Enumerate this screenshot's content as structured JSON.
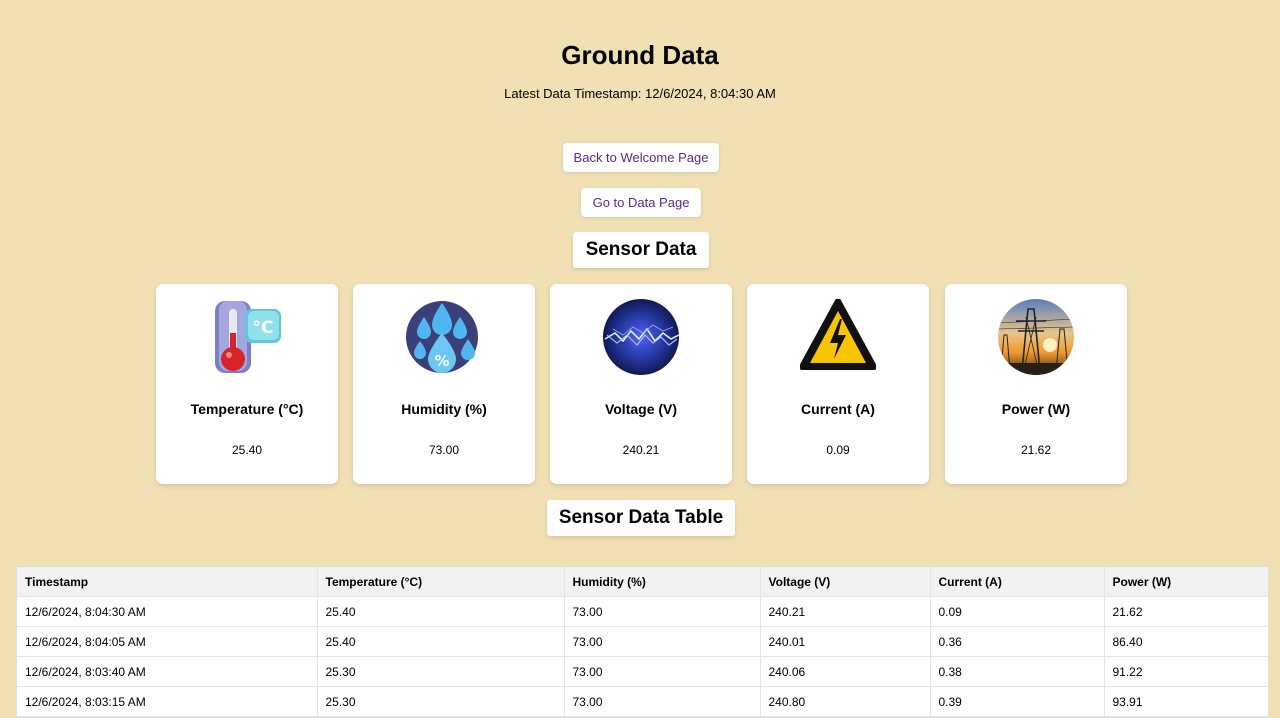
{
  "header": {
    "title": "Ground Data",
    "timestamp_text": "Latest Data Timestamp: 12/6/2024, 8:04:30 AM"
  },
  "nav": {
    "back_label": "Back to Welcome Page",
    "data_label": "Go to Data Page"
  },
  "sensors": {
    "title": "Sensor Data",
    "cards": [
      {
        "label": "Temperature (°C)",
        "value": "25.40",
        "icon": "thermometer-icon"
      },
      {
        "label": "Humidity (%)",
        "value": "73.00",
        "icon": "humidity-drops-icon"
      },
      {
        "label": "Voltage (V)",
        "value": "240.21",
        "icon": "electric-arc-icon"
      },
      {
        "label": "Current (A)",
        "value": "0.09",
        "icon": "high-voltage-warning-icon"
      },
      {
        "label": "Power (W)",
        "value": "21.62",
        "icon": "power-tower-icon"
      }
    ]
  },
  "table": {
    "title": "Sensor Data Table",
    "columns": [
      "Timestamp",
      "Temperature (°C)",
      "Humidity (%)",
      "Voltage (V)",
      "Current (A)",
      "Power (W)"
    ],
    "rows": [
      [
        "12/6/2024, 8:04:30 AM",
        "25.40",
        "73.00",
        "240.21",
        "0.09",
        "21.62"
      ],
      [
        "12/6/2024, 8:04:05 AM",
        "25.40",
        "73.00",
        "240.01",
        "0.36",
        "86.40"
      ],
      [
        "12/6/2024, 8:03:40 AM",
        "25.30",
        "73.00",
        "240.06",
        "0.38",
        "91.22"
      ],
      [
        "12/6/2024, 8:03:15 AM",
        "25.30",
        "73.00",
        "240.80",
        "0.39",
        "93.91"
      ]
    ]
  },
  "colors": {
    "background": "#f2e0b5",
    "link_text": "#5c2a86",
    "card_bg": "#ffffff"
  }
}
